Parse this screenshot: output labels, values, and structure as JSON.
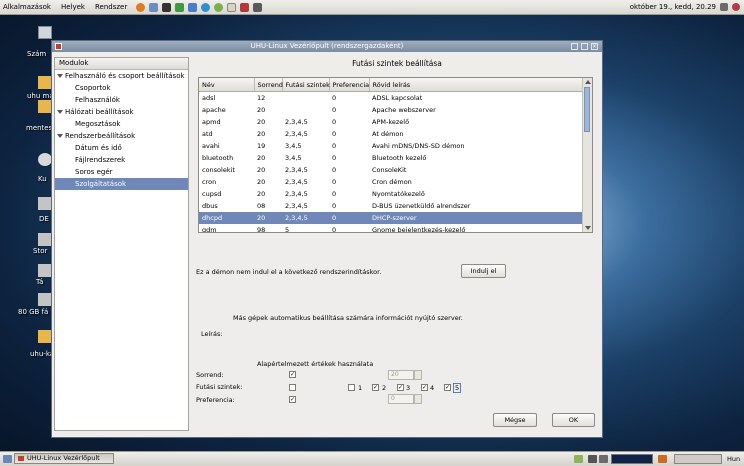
{
  "top_panel": {
    "menus": [
      "Alkalmazások",
      "Helyek",
      "Rendszer"
    ],
    "clock": "október 19., kedd, 20.29"
  },
  "desktop_icons": [
    "Szám",
    "uhu ma",
    "mentes",
    "Ku",
    "DE",
    "Stor",
    "Tá",
    "80 GB fá",
    "uhu-ka"
  ],
  "window": {
    "title": "UHU-Linux Vezérlőpult (rendszergazdaként)",
    "sidebar": {
      "header": "Modulok",
      "items": [
        {
          "label": "Felhasználó és csoport beállítások"
        },
        {
          "label": "Csoportok"
        },
        {
          "label": "Felhasználók"
        },
        {
          "label": "Hálózati beállítások"
        },
        {
          "label": "Megosztások"
        },
        {
          "label": "Rendszerbeállítások"
        },
        {
          "label": "Dátum és idő"
        },
        {
          "label": "Fájlrendszerek"
        },
        {
          "label": "Soros egér"
        },
        {
          "label": "Szolgáltatások"
        }
      ]
    },
    "panel_title": "Futási szintek beállítása",
    "table": {
      "headers": [
        "Név",
        "Sorrend",
        "Futási szintek",
        "Preferencia",
        "Rövid leírás"
      ],
      "rows": [
        [
          "adsl",
          "12",
          "",
          "0",
          "ADSL kapcsolat"
        ],
        [
          "apache",
          "20",
          "",
          "0",
          "Apache webszerver"
        ],
        [
          "apmd",
          "20",
          "2,3,4,5",
          "0",
          "APM-kezelő"
        ],
        [
          "atd",
          "20",
          "2,3,4,5",
          "0",
          "At démon"
        ],
        [
          "avahi",
          "19",
          "3,4,5",
          "0",
          "Avahi mDNS/DNS-SD démon"
        ],
        [
          "bluetooth",
          "20",
          "3,4,5",
          "0",
          "Bluetooth kezelő"
        ],
        [
          "consolekit",
          "20",
          "2,3,4,5",
          "0",
          "ConsoleKit"
        ],
        [
          "cron",
          "20",
          "2,3,4,5",
          "0",
          "Cron démon"
        ],
        [
          "cupsd",
          "20",
          "2,3,4,5",
          "0",
          "Nyomtatókezelő"
        ],
        [
          "dbus",
          "08",
          "2,3,4,5",
          "0",
          "D-BUS üzenetküldő alrendszer"
        ],
        [
          "dhcpd",
          "20",
          "2,3,4,5",
          "0",
          "DHCP-szerver"
        ],
        [
          "gdm",
          "98",
          "5",
          "0",
          "Gnome bejelentkezés-kezelő"
        ]
      ]
    },
    "status_text": "Ez a démon nem indul el a következő rendszerindításkor.",
    "start_button": "Indulj el",
    "description_text": "Más gépek automatikus beállítása számára információt nyújtó szerver.",
    "description_label": "Leírás:",
    "defaults_label": "Alapértelmezett értékek használata",
    "order_label": "Sorrend:",
    "runlevels_label": "Futási szintek:",
    "preference_label": "Preferencia:",
    "order_value": "20",
    "preference_value": "0",
    "runlevels": [
      {
        "label": "1",
        "checked": false
      },
      {
        "label": "2",
        "checked": true
      },
      {
        "label": "3",
        "checked": true
      },
      {
        "label": "4",
        "checked": true
      },
      {
        "label": "5",
        "checked": true
      }
    ],
    "cancel_button": "Mégse",
    "ok_button": "OK"
  },
  "taskbar": {
    "task_label": "UHU-Linux Vezérlőpult",
    "workspace_label": "Hun"
  }
}
